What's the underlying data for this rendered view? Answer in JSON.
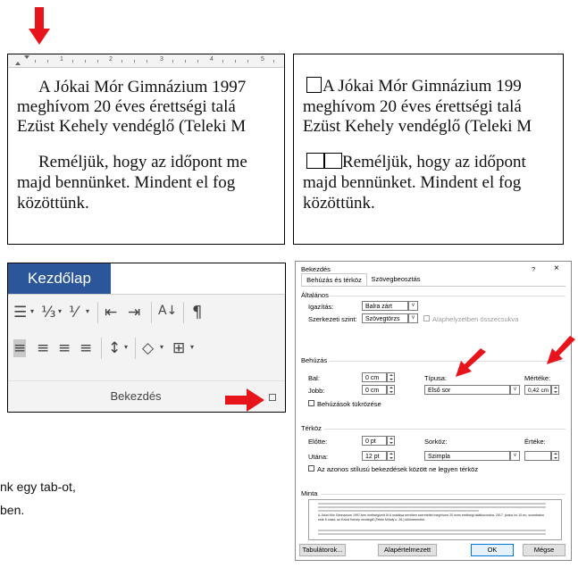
{
  "panel_tl": {
    "ruler_numbers": [
      "1",
      "2",
      "3",
      "4",
      "5"
    ],
    "lines": [
      "A Jókai Mór Gimnázium 1997",
      "meghívom 20 éves érettségi talá",
      "Ezüst Kehely vendéglő (Teleki M",
      "Reméljük, hogy az időpont me",
      "majd bennünket. Mindent el fog",
      "közöttünk."
    ]
  },
  "panel_tr": {
    "lines": [
      "A Jókai Mór Gimnázium 199",
      "meghívom 20 éves érettségi talá",
      "Ezüst Kehely vendéglő (Teleki M",
      "Reméljük, hogy az időpont",
      "majd bennünket. Mindent el fog",
      "közöttünk."
    ]
  },
  "ribbon": {
    "tab_label": "Kezdőlap",
    "group_label": "Bekezdés",
    "icons_row1": [
      "bullets-icon",
      "numbering-icon",
      "multilevel-list-icon",
      "decrease-indent-icon",
      "increase-indent-icon",
      "sort-icon",
      "pilcrow-icon"
    ],
    "icons_row2": [
      "align-left-icon",
      "align-center-icon",
      "align-right-icon",
      "justify-icon",
      "line-spacing-icon",
      "shading-icon",
      "borders-icon"
    ],
    "icon_glyphs_row1": [
      "☰",
      "⅓",
      "⅟",
      "⇤",
      "⇥",
      "A↓",
      "¶"
    ],
    "icon_glyphs_row2": [
      "≡",
      "≡",
      "≡",
      "≡",
      "↕",
      "◇",
      "⊞"
    ]
  },
  "left_partial_text": {
    "line1": "nk egy tab-ot,",
    "line2": "ben."
  },
  "dialog": {
    "title": "Bekezdés",
    "help": "?",
    "close": "×",
    "tabs": [
      "Behúzás és térköz",
      "Szövegbeosztás"
    ],
    "general": {
      "header": "Általános",
      "alignment_label": "Igazítás:",
      "alignment_value": "Balra zárt",
      "outline_label": "Szerkezeti szint:",
      "outline_value": "Szövegtörzs",
      "collapsed_label": "Alaphelyzetben összecsukva"
    },
    "indent": {
      "header": "Behúzás",
      "left_label": "Bal:",
      "left_value": "0 cm",
      "right_label": "Jobb:",
      "right_value": "0 cm",
      "type_label": "Típusa:",
      "type_value": "Első sor",
      "by_label": "Mértéke:",
      "by_value": "0,42 cm",
      "mirror_label": "Behúzások tükrözése"
    },
    "spacing": {
      "header": "Térköz",
      "before_label": "Előtte:",
      "before_value": "0 pt",
      "after_label": "Utána:",
      "after_value": "12 pt",
      "line_label": "Sorköz:",
      "line_value": "Szimpla",
      "at_label": "Értéke:",
      "at_value": "",
      "no_space_label": "Az azonos stílusú bekezdések között ne legyen térköz"
    },
    "preview": {
      "header": "Minta",
      "text": "A Jókai Mór Gimnázium 1997-ben érettségizett IV.A osztálya nevében szeretettel meghívom 20 éves érettségi találkozónkra, 2017. június hó 10-én, szombaton este 8 órára, az Ezüst Kehely vendéglő (Teleki Mihály u. 26.) különtermébe."
    },
    "buttons": {
      "tabs": "Tabulátorok...",
      "default": "Alapértelmezett",
      "ok": "OK",
      "cancel": "Mégse"
    }
  },
  "colors": {
    "ribbon_blue": "#2b579a",
    "arrow_red": "#e8141b"
  }
}
